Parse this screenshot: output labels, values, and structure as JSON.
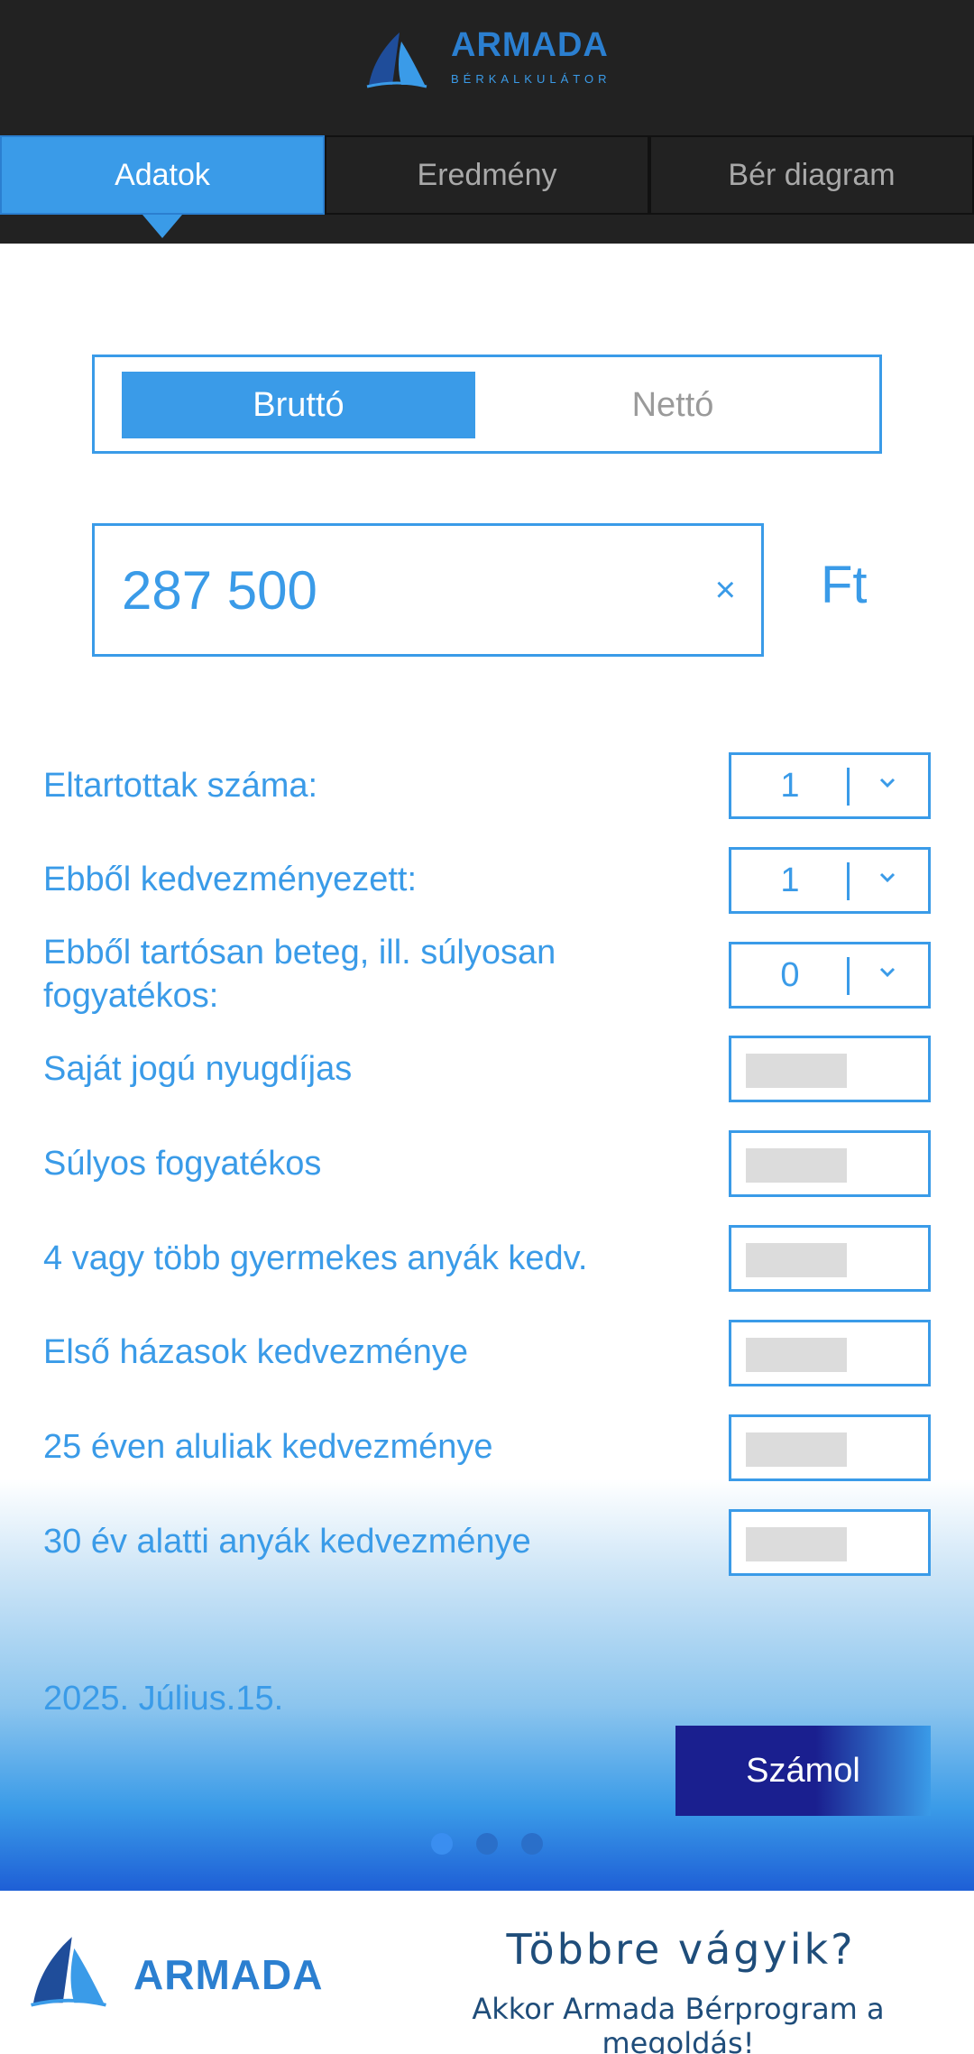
{
  "app": {
    "brand_name": "ARMADA",
    "brand_sub": "BÉRKALKULÁTOR"
  },
  "tabs": [
    {
      "label": "Adatok",
      "active": true
    },
    {
      "label": "Eredmény",
      "active": false
    },
    {
      "label": "Bér diagram",
      "active": false
    }
  ],
  "mode_toggle": {
    "options": [
      "Bruttó",
      "Nettó"
    ],
    "selected": "Bruttó"
  },
  "amount": {
    "value": "287 500",
    "clear_icon": "×",
    "currency": "Ft"
  },
  "selects": [
    {
      "label": "Eltartottak száma:",
      "value": "1"
    },
    {
      "label": "Ebből kedvezményezett:",
      "value": "1"
    },
    {
      "label": "Ebből tartósan beteg, ill. súlyosan fogyatékos:",
      "value": "0"
    }
  ],
  "toggles": [
    {
      "label": "Saját jogú nyugdíjas",
      "checked": false
    },
    {
      "label": "Súlyos fogyatékos",
      "checked": false
    },
    {
      "label": "4 vagy több gyermekes anyák kedv.",
      "checked": false
    },
    {
      "label": "Első házasok kedvezménye",
      "checked": false
    },
    {
      "label": "25 éven aluliak kedvezménye",
      "checked": false
    },
    {
      "label": "30 év alatti anyák kedvezménye",
      "checked": false
    }
  ],
  "footer": {
    "date": "2025. Július.15.",
    "calculate_label": "Számol",
    "pager": {
      "count": 3,
      "active_index": 0
    }
  },
  "banner": {
    "brand_name": "ARMADA",
    "title": "Többre vágyik?",
    "subtitle": "Akkor Armada Bérprogram a megoldás!"
  },
  "colors": {
    "accent": "#3a9be8",
    "header_bg": "#222222",
    "button_dark": "#1a1f8f",
    "banner_text": "#1f4d7a"
  }
}
